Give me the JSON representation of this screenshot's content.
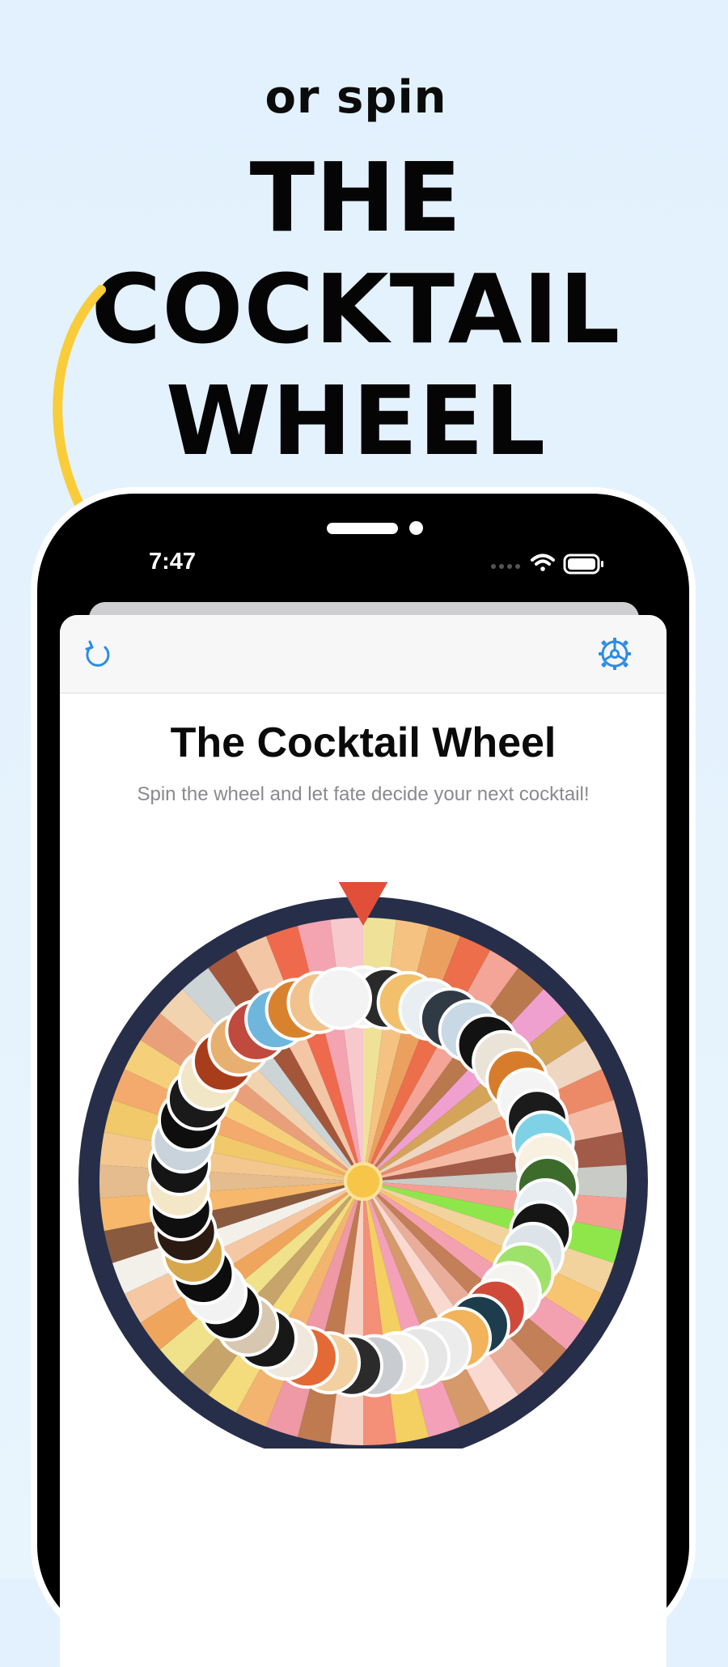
{
  "promo": {
    "subtitle": "or spin",
    "title_line1": "THE COCKTAIL",
    "title_line2": "WHEEL",
    "arrow_color": "#f9cd3a"
  },
  "status_bar": {
    "time": "7:47",
    "wifi_icon": "wifi-icon",
    "battery_icon": "battery-icon"
  },
  "navbar": {
    "refresh_icon": "refresh-icon",
    "settings_icon": "gear-icon",
    "accent": "#2b8de4"
  },
  "app": {
    "title": "The Cocktail Wheel",
    "subtitle": "Spin the wheel and let fate decide your next cocktail!"
  },
  "wheel": {
    "rim_color": "#262e4a",
    "pointer_color": "#e14f38",
    "hub_color": "#f7c548",
    "segment_colors": [
      "#f0e199",
      "#f5c281",
      "#eba060",
      "#ec6e4b",
      "#f4a597",
      "#b9794d",
      "#f0a0cf",
      "#d4a459",
      "#eed6c0",
      "#ec8a68",
      "#f6bba4",
      "#a25b48",
      "#c9cbc6",
      "#f49f92",
      "#8fe64a",
      "#f2d39e",
      "#f7c56f",
      "#f3a0b0",
      "#c27f58",
      "#e9ad9a",
      "#f9d9d0",
      "#d6996c",
      "#f4a0b8",
      "#f3d061",
      "#f48f78",
      "#f6d3c4",
      "#c07a4f",
      "#ef98a6",
      "#f2b46f",
      "#f4dc7c",
      "#c6a46a",
      "#f0e28a",
      "#f0a55c",
      "#f5c8a3",
      "#f3f0ea",
      "#8a5a3e",
      "#f7b86b",
      "#e4bc8d",
      "#f3c78d",
      "#f1c86a",
      "#f4aa6c",
      "#f6cf7b",
      "#e9a07a",
      "#f1d3b0",
      "#ccd4d6",
      "#a4563a",
      "#f3c6a6",
      "#ef6a4c",
      "#f4a3b1",
      "#f7c9cc"
    ],
    "photo_colors": [
      "#f3f3f3",
      "#2a2a2a",
      "#f2c06a",
      "#e9eef2",
      "#2f3a44",
      "#c8d8e4",
      "#121212",
      "#eae3d8",
      "#d77c2a",
      "#f4f4f4",
      "#1b1b1b",
      "#7fd2e6",
      "#f8f0e0",
      "#3d6b2c",
      "#e7edf1",
      "#151515",
      "#dce4ea",
      "#9fe26a",
      "#f5f3ef",
      "#d04a3a",
      "#1d3d4d",
      "#f2b35a",
      "#ececec",
      "#e6e6e6",
      "#f6f2ea",
      "#c9ccd0",
      "#2b2b2b",
      "#f3d0a0",
      "#e36a35",
      "#f0e8dc",
      "#181818",
      "#d7c6b0",
      "#101010",
      "#f2f2f2",
      "#0d0d0d",
      "#d8a64b",
      "#2a1a12",
      "#0f0f0f",
      "#f4e7c8",
      "#151515",
      "#c9d3db",
      "#0e0e0e",
      "#1a1a1a",
      "#f1e7c6",
      "#a83d1c",
      "#e8b070",
      "#c04a3e",
      "#6fb6dd",
      "#d9822e",
      "#f2c28c",
      "#f3f3f3"
    ]
  }
}
